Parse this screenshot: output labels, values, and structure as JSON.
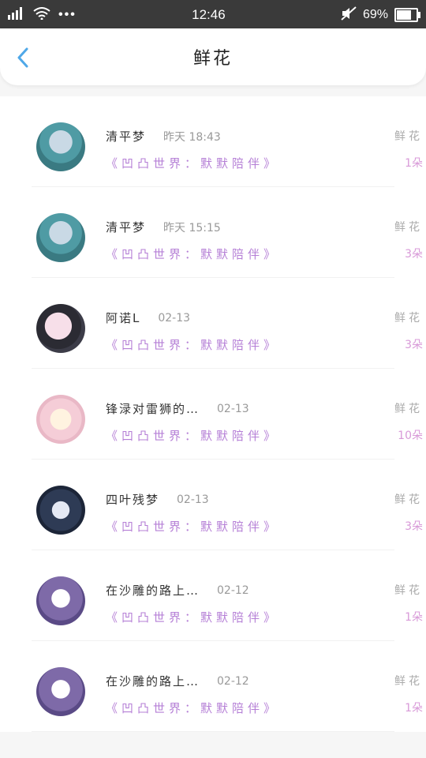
{
  "status_bar": {
    "time": "12:46",
    "battery": "69%",
    "dots": "•••"
  },
  "header": {
    "title": "鲜花"
  },
  "items": [
    {
      "name": "清平梦",
      "time": "昨天 18:43",
      "gift": "《凹凸世界：默默陪伴》",
      "label": "鲜花",
      "count": "1朵",
      "avatar": "av1"
    },
    {
      "name": "清平梦",
      "time": "昨天 15:15",
      "gift": "《凹凸世界：默默陪伴》",
      "label": "鲜花",
      "count": "3朵",
      "avatar": "av1"
    },
    {
      "name": "阿诺L",
      "time": "02-13",
      "gift": "《凹凸世界：默默陪伴》",
      "label": "鲜花",
      "count": "3朵",
      "avatar": "av2"
    },
    {
      "name": "锋渌对雷狮的…",
      "time": "02-13",
      "gift": "《凹凸世界：默默陪伴》",
      "label": "鲜花",
      "count": "10朵",
      "avatar": "av3"
    },
    {
      "name": "四叶残梦",
      "time": "02-13",
      "gift": "《凹凸世界：默默陪伴》",
      "label": "鲜花",
      "count": "3朵",
      "avatar": "av4"
    },
    {
      "name": "在沙雕的路上…",
      "time": "02-12",
      "gift": "《凹凸世界：默默陪伴》",
      "label": "鲜花",
      "count": "1朵",
      "avatar": "av5"
    },
    {
      "name": "在沙雕的路上…",
      "time": "02-12",
      "gift": "《凹凸世界：默默陪伴》",
      "label": "鲜花",
      "count": "1朵",
      "avatar": "av5"
    }
  ]
}
